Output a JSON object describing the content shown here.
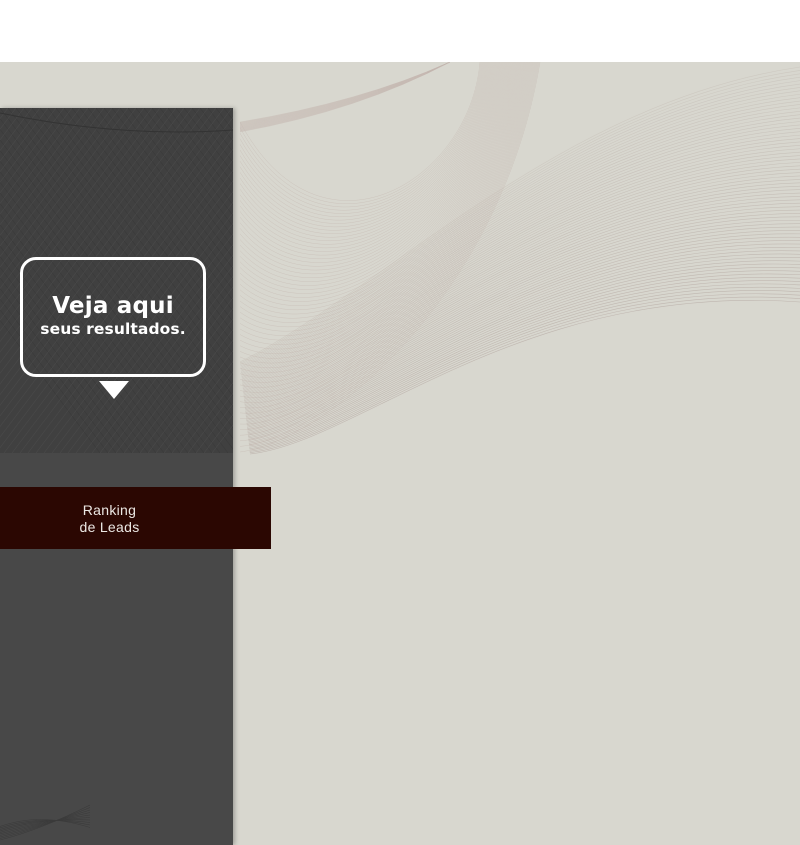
{
  "callout": {
    "title": "Veja aqui",
    "subtitle": "seus resultados."
  },
  "menu": {
    "ranking_line1": "Ranking",
    "ranking_line2": "de Leads"
  },
  "colors": {
    "background": "#d8d7cf",
    "sidebar": "#484848",
    "sidebar_top": "#404040",
    "ranking_button": "#2b0702",
    "callout_border": "#ffffff"
  }
}
